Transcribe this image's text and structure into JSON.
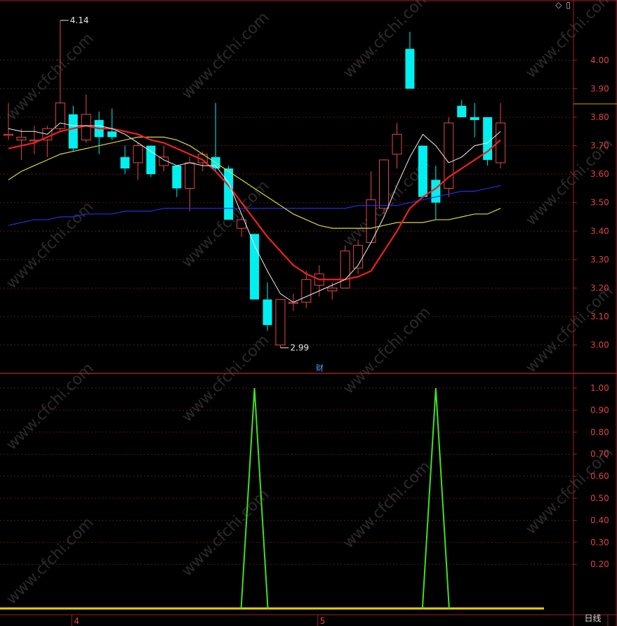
{
  "corner_icons": [
    "diamond-icon",
    "copy-icon"
  ],
  "period_label": "日线",
  "colors": {
    "up": "#e04848",
    "down": "#00f0f0",
    "ma5": "#f0f0f0",
    "ma10": "#f02020",
    "ma20": "#d8d840",
    "ma60": "#2030e0",
    "indicator": "#40e020",
    "baseline": "#e8d000",
    "axis": "#a02020",
    "grid": "#5a1818"
  },
  "chart_data": [
    {
      "type": "candlestick",
      "ylim": [
        2.93,
        4.15
      ],
      "y_ticks": [
        "3.00",
        "3.10",
        "3.20",
        "3.30",
        "3.40",
        "3.50",
        "3.60",
        "3.70",
        "3.80",
        "3.90",
        "4.00"
      ],
      "high_annotation": "4.14",
      "low_annotation": "2.99",
      "event_marker": "财",
      "candles": [
        {
          "o": 3.74,
          "h": 3.85,
          "l": 3.72,
          "c": 3.74
        },
        {
          "o": 3.72,
          "h": 3.76,
          "l": 3.65,
          "c": 3.73
        },
        {
          "o": 3.72,
          "h": 3.77,
          "l": 3.67,
          "c": 3.72
        },
        {
          "o": 3.72,
          "h": 3.77,
          "l": 3.66,
          "c": 3.76
        },
        {
          "o": 3.76,
          "h": 4.14,
          "l": 3.75,
          "c": 3.85
        },
        {
          "o": 3.81,
          "h": 3.84,
          "l": 3.68,
          "c": 3.69
        },
        {
          "o": 3.72,
          "h": 3.88,
          "l": 3.71,
          "c": 3.81
        },
        {
          "o": 3.79,
          "h": 3.82,
          "l": 3.67,
          "c": 3.73
        },
        {
          "o": 3.75,
          "h": 3.83,
          "l": 3.72,
          "c": 3.73
        },
        {
          "o": 3.66,
          "h": 3.7,
          "l": 3.6,
          "c": 3.62
        },
        {
          "o": 3.64,
          "h": 3.71,
          "l": 3.58,
          "c": 3.7
        },
        {
          "o": 3.7,
          "h": 3.7,
          "l": 3.59,
          "c": 3.6
        },
        {
          "o": 3.63,
          "h": 3.7,
          "l": 3.61,
          "c": 3.66
        },
        {
          "o": 3.63,
          "h": 3.63,
          "l": 3.52,
          "c": 3.55
        },
        {
          "o": 3.55,
          "h": 3.66,
          "l": 3.47,
          "c": 3.64
        },
        {
          "o": 3.64,
          "h": 3.68,
          "l": 3.61,
          "c": 3.67
        },
        {
          "o": 3.66,
          "h": 3.85,
          "l": 3.61,
          "c": 3.62
        },
        {
          "o": 3.62,
          "h": 3.63,
          "l": 3.44,
          "c": 3.44
        },
        {
          "o": 3.41,
          "h": 3.45,
          "l": 3.38,
          "c": 3.44
        },
        {
          "o": 3.39,
          "h": 3.39,
          "l": 3.16,
          "c": 3.16
        },
        {
          "o": 3.16,
          "h": 3.22,
          "l": 3.05,
          "c": 3.07
        },
        {
          "o": 3.0,
          "h": 3.16,
          "l": 2.99,
          "c": 3.16
        },
        {
          "o": 3.15,
          "h": 3.18,
          "l": 3.12,
          "c": 3.15
        },
        {
          "o": 3.15,
          "h": 3.26,
          "l": 3.13,
          "c": 3.23
        },
        {
          "o": 3.21,
          "h": 3.28,
          "l": 3.17,
          "c": 3.25
        },
        {
          "o": 3.19,
          "h": 3.22,
          "l": 3.16,
          "c": 3.2
        },
        {
          "o": 3.2,
          "h": 3.35,
          "l": 3.2,
          "c": 3.33
        },
        {
          "o": 3.27,
          "h": 3.37,
          "l": 3.25,
          "c": 3.35
        },
        {
          "o": 3.36,
          "h": 3.61,
          "l": 3.36,
          "c": 3.51
        },
        {
          "o": 3.48,
          "h": 3.65,
          "l": 3.46,
          "c": 3.65
        },
        {
          "o": 3.67,
          "h": 3.78,
          "l": 3.62,
          "c": 3.74
        },
        {
          "o": 4.04,
          "h": 4.1,
          "l": 3.9,
          "c": 3.9
        },
        {
          "o": 3.7,
          "h": 3.7,
          "l": 3.52,
          "c": 3.52
        },
        {
          "o": 3.58,
          "h": 3.63,
          "l": 3.44,
          "c": 3.5
        },
        {
          "o": 3.55,
          "h": 3.8,
          "l": 3.52,
          "c": 3.78
        },
        {
          "o": 3.84,
          "h": 3.86,
          "l": 3.8,
          "c": 3.8
        },
        {
          "o": 3.8,
          "h": 3.85,
          "l": 3.73,
          "c": 3.79
        },
        {
          "o": 3.8,
          "h": 3.8,
          "l": 3.63,
          "c": 3.65
        },
        {
          "o": 3.64,
          "h": 3.85,
          "l": 3.62,
          "c": 3.78
        }
      ],
      "ma5": [
        3.76,
        3.75,
        3.75,
        3.74,
        3.78,
        3.77,
        3.77,
        3.77,
        3.76,
        3.74,
        3.71,
        3.68,
        3.65,
        3.63,
        3.64,
        3.63,
        3.63,
        3.57,
        3.46,
        3.35,
        3.26,
        3.18,
        3.15,
        3.17,
        3.19,
        3.21,
        3.23,
        3.28,
        3.36,
        3.45,
        3.56,
        3.66,
        3.74,
        3.7,
        3.64,
        3.66,
        3.7,
        3.71,
        3.75
      ],
      "ma10": [
        3.69,
        3.7,
        3.71,
        3.73,
        3.75,
        3.76,
        3.77,
        3.76,
        3.76,
        3.75,
        3.74,
        3.72,
        3.71,
        3.69,
        3.67,
        3.65,
        3.61,
        3.56,
        3.5,
        3.44,
        3.38,
        3.33,
        3.28,
        3.25,
        3.23,
        3.23,
        3.23,
        3.24,
        3.26,
        3.33,
        3.4,
        3.48,
        3.52,
        3.55,
        3.59,
        3.62,
        3.65,
        3.68,
        3.72
      ],
      "ma20": [
        3.58,
        3.61,
        3.63,
        3.65,
        3.67,
        3.68,
        3.69,
        3.7,
        3.71,
        3.72,
        3.73,
        3.73,
        3.73,
        3.72,
        3.7,
        3.67,
        3.64,
        3.61,
        3.58,
        3.55,
        3.52,
        3.49,
        3.46,
        3.44,
        3.42,
        3.41,
        3.41,
        3.41,
        3.41,
        3.42,
        3.43,
        3.43,
        3.43,
        3.44,
        3.44,
        3.45,
        3.46,
        3.46,
        3.48
      ],
      "ma60": [
        3.42,
        3.43,
        3.44,
        3.44,
        3.45,
        3.45,
        3.46,
        3.46,
        3.46,
        3.47,
        3.47,
        3.47,
        3.48,
        3.48,
        3.48,
        3.48,
        3.48,
        3.48,
        3.48,
        3.48,
        3.48,
        3.48,
        3.48,
        3.48,
        3.48,
        3.48,
        3.48,
        3.49,
        3.49,
        3.49,
        3.49,
        3.5,
        3.51,
        3.52,
        3.53,
        3.54,
        3.54,
        3.55,
        3.56
      ]
    },
    {
      "type": "line",
      "ylim": [
        0,
        1.05
      ],
      "y_ticks": [
        "1.00",
        "0.90",
        "0.80",
        "0.70",
        "0.60",
        "0.50",
        "0.40",
        "0.30",
        "0.20"
      ],
      "values": [
        0,
        0,
        0,
        0,
        0,
        0,
        0,
        0,
        0,
        0,
        0,
        0,
        0,
        0,
        0,
        0,
        0,
        0,
        0,
        1,
        0,
        0,
        0,
        0,
        0,
        0,
        0,
        0,
        0,
        0,
        0,
        0,
        0,
        1,
        0,
        0,
        0,
        0,
        0
      ]
    }
  ],
  "date_axis": {
    "labels": [
      {
        "label": "4",
        "index": 5
      },
      {
        "label": "5",
        "index": 24
      }
    ]
  }
}
